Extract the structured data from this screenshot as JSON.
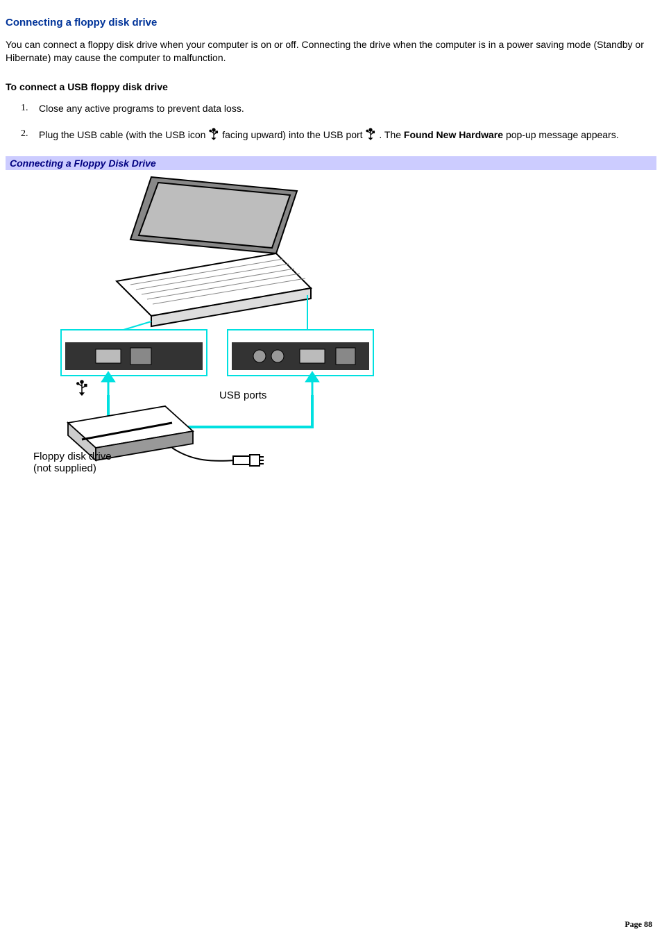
{
  "section_title": "Connecting a floppy disk drive",
  "intro_paragraph": "You can connect a floppy disk drive when your computer is on or off. Connecting the drive when the computer is in a power saving mode (Standby or Hibernate) may cause the computer to malfunction.",
  "sub_heading": "To connect a USB floppy disk drive",
  "steps": {
    "s1": "Close any active programs to prevent data loss.",
    "s2_a": "Plug the USB cable (with the USB icon ",
    "s2_b": " facing upward) into the USB port ",
    "s2_c": " . The ",
    "s2_bold": "Found New Hardware",
    "s2_d": " pop-up message appears."
  },
  "figure_caption": "Connecting a Floppy Disk Drive",
  "figure_labels": {
    "usb_ports": "USB ports",
    "floppy_line1": "Floppy disk drive",
    "floppy_line2": "(not supplied)"
  },
  "page_label": "Page 88"
}
